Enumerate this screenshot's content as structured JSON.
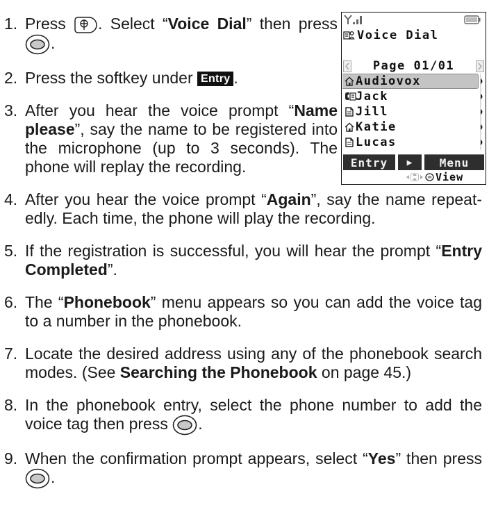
{
  "steps": [
    {
      "num": "1.",
      "t1": "Press ",
      "t2": ". Select “",
      "b1": "Voice Dial",
      "t3": "” then press ",
      "t4": "."
    },
    {
      "num": "2.",
      "t1": "Press the softkey under ",
      "badge": "Entry",
      "t2": "."
    },
    {
      "num": "3.",
      "t1": "After you hear the voice prompt “",
      "b1": "Name please",
      "t2": "”, say the name to be registered into the microphone (up to 3 seconds). The phone will replay the recording."
    },
    {
      "num": "4.",
      "t1": "After you hear the voice prompt “",
      "b1": "Again",
      "t2": "”, say the name repeat­edly. Each time, the phone will play the recording."
    },
    {
      "num": "5.",
      "t1": "If the registration is successful, you will hear the prompt “",
      "b1": "Entry Completed",
      "t2": "”."
    },
    {
      "num": "6.",
      "t1": "The “",
      "b1": "Phonebook",
      "t2": "” menu appears so you can add the voice tag to a number in the phonebook."
    },
    {
      "num": "7.",
      "t1": "Locate the desired address using any of the phonebook search modes. (See ",
      "b1": "Searching the Phonebook",
      "t2": " on page 45.)"
    },
    {
      "num": "8.",
      "t1": "In the phonebook entry, select the phone number to add the voice tag then press ",
      "t2": "."
    },
    {
      "num": "9.",
      "t1": "When the confirmation prompt appears, select “",
      "b1": "Yes",
      "t2": "” then press ",
      "t3": "."
    }
  ],
  "icons": {
    "menu_key": "menu-key-icon",
    "ok_key": "ok-key-icon"
  },
  "phone": {
    "status_icons": [
      "signal-icon",
      "battery-icon"
    ],
    "title_icon": "voice-dial-icon",
    "title": "Voice Dial",
    "page": "Page 01/01",
    "contacts": [
      {
        "name": "Audiovox",
        "icon": "home-icon",
        "selected": true
      },
      {
        "name": "Jack",
        "icon": "phone-card-icon",
        "selected": false
      },
      {
        "name": "Jill",
        "icon": "document-icon",
        "selected": false
      },
      {
        "name": "Katie",
        "icon": "home-icon",
        "selected": false
      },
      {
        "name": "Lucas",
        "icon": "document-icon",
        "selected": false
      }
    ],
    "softkeys": {
      "left": "Entry",
      "center": "▶",
      "right": "Menu"
    },
    "hint_icons": [
      "nav-key-icon",
      "ok-key-small-icon"
    ],
    "hint": "View"
  },
  "colors": {
    "text": "#1a1a1a",
    "badge_bg": "#111111",
    "badge_text": "#ffffff",
    "selection_highlight": "#c4c4c4",
    "softkey_bg": "#2e2e2e",
    "softkey_text": "#f2f2f2"
  }
}
